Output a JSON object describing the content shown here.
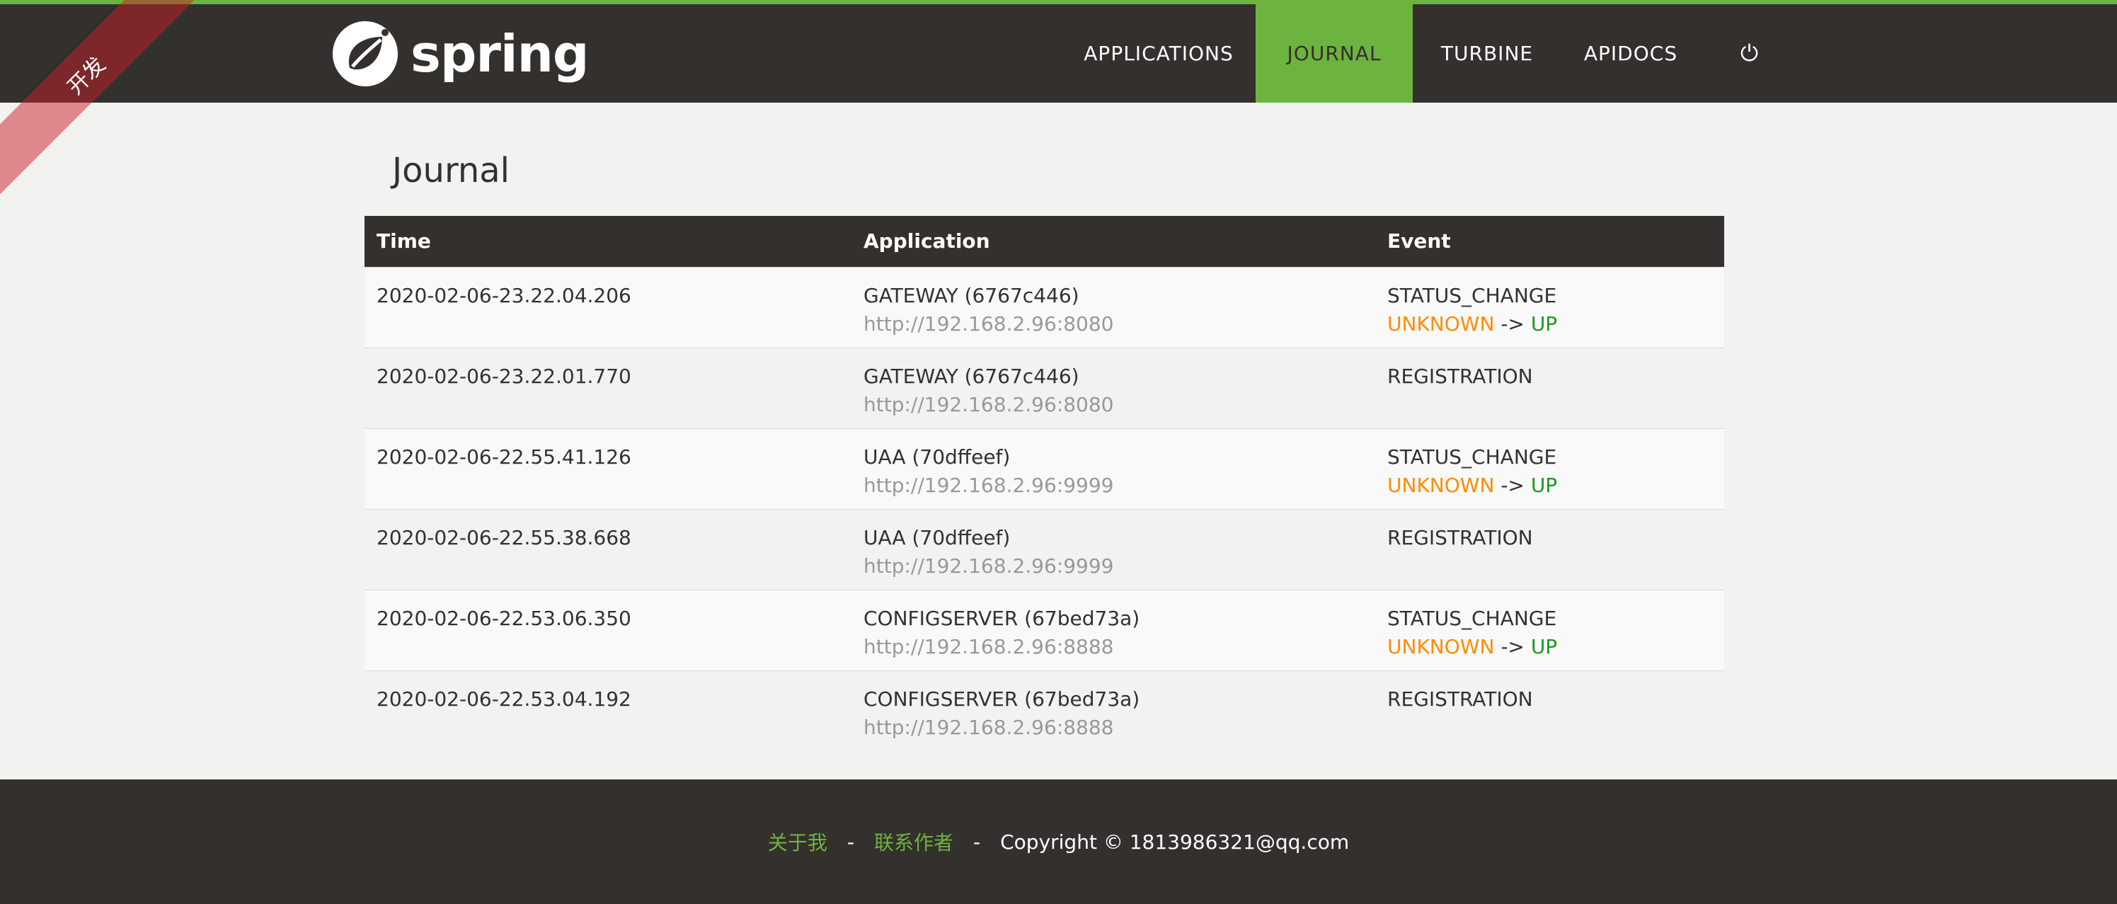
{
  "brand": {
    "name": "spring"
  },
  "ribbon": {
    "label": "开发"
  },
  "nav": {
    "items": [
      {
        "label": "APPLICATIONS"
      },
      {
        "label": "JOURNAL"
      },
      {
        "label": "TURBINE"
      },
      {
        "label": "APIDOCS"
      },
      {
        "label": "⏻"
      }
    ]
  },
  "page": {
    "title": "Journal"
  },
  "table": {
    "headers": [
      "Time",
      "Application",
      "Event"
    ],
    "rows": [
      {
        "time": "2020-02-06-23.22.04.206",
        "app": "GATEWAY (6767c446)",
        "url": "http://192.168.2.96:8080",
        "event": "STATUS_CHANGE",
        "from": "UNKNOWN",
        "arrow": "->",
        "to": "UP"
      },
      {
        "time": "2020-02-06-23.22.01.770",
        "app": "GATEWAY (6767c446)",
        "url": "http://192.168.2.96:8080",
        "event": "REGISTRATION"
      },
      {
        "time": "2020-02-06-22.55.41.126",
        "app": "UAA (70dffeef)",
        "url": "http://192.168.2.96:9999",
        "event": "STATUS_CHANGE",
        "from": "UNKNOWN",
        "arrow": "->",
        "to": "UP"
      },
      {
        "time": "2020-02-06-22.55.38.668",
        "app": "UAA (70dffeef)",
        "url": "http://192.168.2.96:9999",
        "event": "REGISTRATION"
      },
      {
        "time": "2020-02-06-22.53.06.350",
        "app": "CONFIGSERVER (67bed73a)",
        "url": "http://192.168.2.96:8888",
        "event": "STATUS_CHANGE",
        "from": "UNKNOWN",
        "arrow": "->",
        "to": "UP"
      },
      {
        "time": "2020-02-06-22.53.04.192",
        "app": "CONFIGSERVER (67bed73a)",
        "url": "http://192.168.2.96:8888",
        "event": "REGISTRATION"
      }
    ]
  },
  "footer": {
    "about": "关于我",
    "contact": "联系作者",
    "separator": "-",
    "copyright": "Copyright © 1813986321@qq.com"
  },
  "colors": {
    "brand_green": "#6db33f",
    "header_dark": "#34302d",
    "unknown_orange": "#ff8c00",
    "up_green": "#1a9b1a"
  }
}
